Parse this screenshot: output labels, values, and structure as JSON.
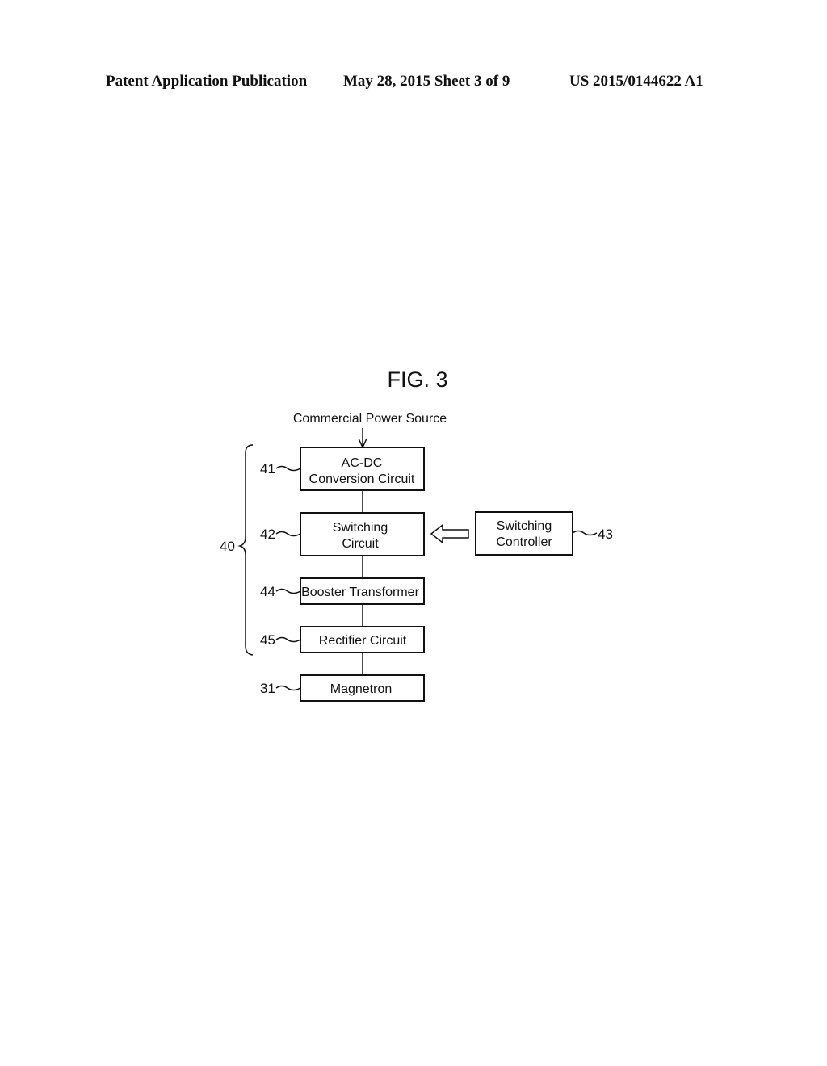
{
  "header": {
    "left": "Patent Application Publication",
    "middle": "May 28, 2015  Sheet 3 of 9",
    "right": "US 2015/0144622 A1"
  },
  "figure": {
    "title": "FIG. 3",
    "input_label": "Commercial Power Source",
    "group_ref": "40",
    "blocks": [
      {
        "ref": "41",
        "lines": [
          "AC-DC",
          "Conversion Circuit"
        ]
      },
      {
        "ref": "42",
        "lines": [
          "Switching",
          "Circuit"
        ]
      },
      {
        "ref": "44",
        "lines": [
          "Booster Transformer"
        ]
      },
      {
        "ref": "45",
        "lines": [
          "Rectifier Circuit"
        ]
      },
      {
        "ref": "31",
        "lines": [
          "Magnetron"
        ]
      }
    ],
    "controller": {
      "ref": "43",
      "lines": [
        "Switching",
        "Controller"
      ]
    }
  }
}
